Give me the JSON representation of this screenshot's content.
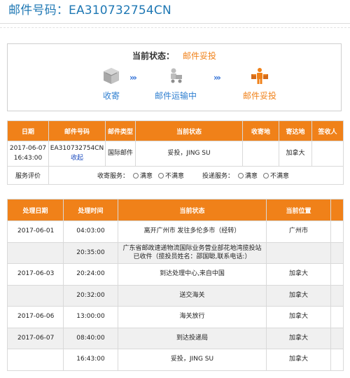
{
  "page": {
    "title": "邮件号码：EA310732754CN"
  },
  "status": {
    "label": "当前状态：",
    "value": "邮件妥投",
    "steps": [
      {
        "label": "收寄",
        "icon": "package-icon",
        "state": "done"
      },
      {
        "label": "邮件运输中",
        "icon": "delivery-truck-icon",
        "state": "done"
      },
      {
        "label": "邮件妥投",
        "icon": "courier-delivery-icon",
        "state": "current"
      }
    ]
  },
  "summary": {
    "headers": [
      "日期",
      "邮件号码",
      "邮件类型",
      "当前状态",
      "收寄地",
      "寄达地",
      "签收人"
    ],
    "row": {
      "date": "2017-06-07 16:43:00",
      "mail_no": "EA310732754CN",
      "collapse_link": "收起",
      "mail_type": "国际邮件",
      "status": "妥投，JING SU",
      "origin": "",
      "destination": "加拿大",
      "signer": ""
    },
    "rating": {
      "label": "服务评价",
      "collect_label": "收寄服务：",
      "deliver_label": "投递服务：",
      "satisfied": "满意",
      "unsatisfied": "不满意"
    }
  },
  "tracking": {
    "headers": [
      "处理日期",
      "处理时间",
      "当前状态",
      "当前位置"
    ],
    "rows": [
      {
        "date": "2017-06-01",
        "time": "04:03:00",
        "status": "离开广州市 发往多伦多市（经转）",
        "location": "广州市"
      },
      {
        "date": "",
        "time": "20:35:00",
        "status": "广东省邮政速递物流国际业务营业部花地湾揽投站已收件（揽投员姓名：邵国聪,联系电话:）",
        "location": ""
      },
      {
        "date": "2017-06-03",
        "time": "20:24:00",
        "status": "到达处理中心,来自中国",
        "location": "加拿大"
      },
      {
        "date": "",
        "time": "20:32:00",
        "status": "送交海关",
        "location": "加拿大"
      },
      {
        "date": "2017-06-06",
        "time": "13:00:00",
        "status": "海关放行",
        "location": "加拿大"
      },
      {
        "date": "2017-06-07",
        "time": "08:40:00",
        "status": "到达投递局",
        "location": "加拿大"
      },
      {
        "date": "",
        "time": "16:43:00",
        "status": "妥投，JING SU",
        "location": "加拿大"
      }
    ]
  },
  "colors": {
    "accent": "#f08119",
    "title": "#1f78b4",
    "link": "#1e4dbf"
  }
}
